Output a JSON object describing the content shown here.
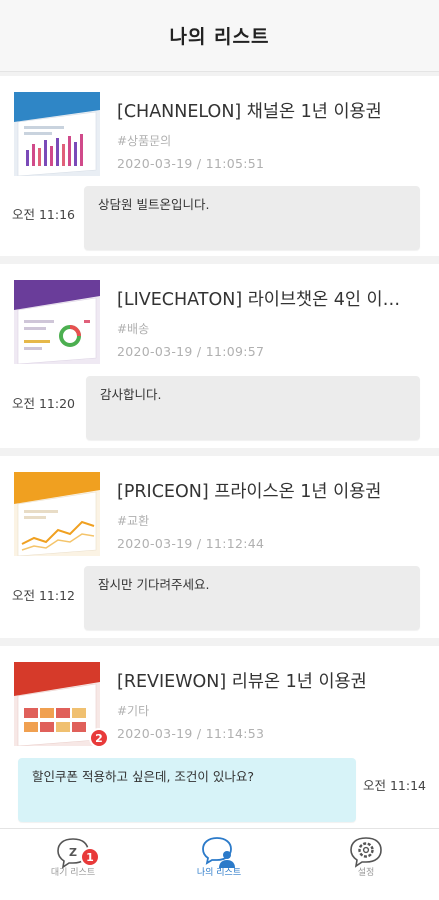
{
  "header": {
    "title": "나의 리스트"
  },
  "items": [
    {
      "title": "[CHANNELON] 채널온 1년 이용권",
      "tag": "#상품문의",
      "datetime": "2020-03-19 / 11:05:51",
      "time": "오전 11:16",
      "message": "상담원 빌트온입니다.",
      "thumb_color": "#2f86c6"
    },
    {
      "title": "[LIVECHATON] 라이브챗온 4인 이…",
      "tag": "#배송",
      "datetime": "2020-03-19 / 11:09:57",
      "time": "오전 11:20",
      "message": "감사합니다.",
      "thumb_color": "#6a3d9a"
    },
    {
      "title": "[PRICEON] 프라이스온 1년 이용권",
      "tag": "#교환",
      "datetime": "2020-03-19 / 11:12:44",
      "time": "오전 11:12",
      "message": "잠시만 기다려주세요.",
      "thumb_color": "#f0a020"
    },
    {
      "title": "[REVIEWON] 리뷰온 1년 이용권",
      "tag": "#기타",
      "datetime": "2020-03-19 / 11:14:53",
      "time": "오전 11:14",
      "message": "할인쿠폰 적용하고 싶은데, 조건이 있나요?",
      "badge": "2",
      "thumb_color": "#d63a2a"
    }
  ],
  "tabs": [
    {
      "label": "대기 리스트",
      "badge": "1",
      "icon": "chat-z-icon"
    },
    {
      "label": "나의 리스트",
      "icon": "chat-person-icon",
      "active": true
    },
    {
      "label": "설정",
      "icon": "gear-icon"
    }
  ],
  "colors": {
    "accent": "#2b7ac9",
    "badge": "#e83a3a",
    "my_bubble": "#d7f3f8",
    "bubble": "#ececec"
  }
}
